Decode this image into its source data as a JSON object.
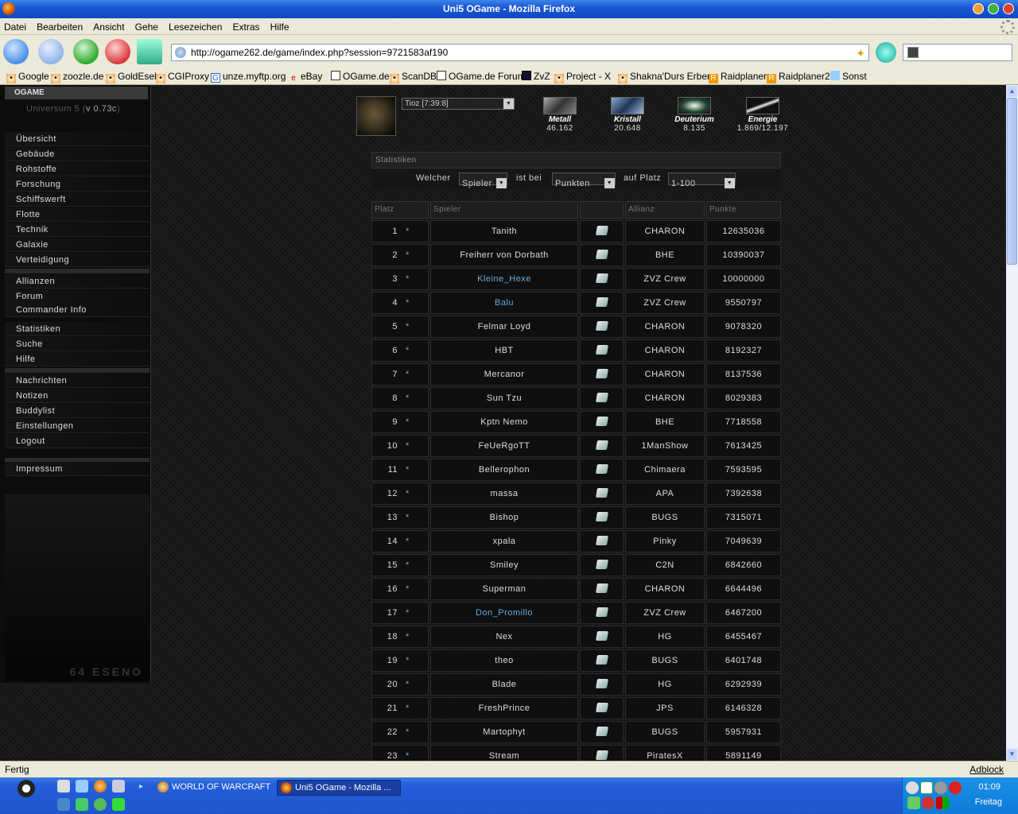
{
  "window": {
    "title": "Uni5 OGame - Mozilla Firefox"
  },
  "menubar": [
    "Datei",
    "Bearbeiten",
    "Ansicht",
    "Gehe",
    "Lesezeichen",
    "Extras",
    "Hilfe"
  ],
  "toolbar": {
    "url": "http://ogame262.de/game/index.php?session=9721583af190",
    "search_value": ""
  },
  "bookmarks": [
    "Google",
    "zoozle.de",
    "GoldEsel",
    "CGIProxy",
    "unze.myftp.org",
    "eBay",
    "OGame.de",
    "ScanDB",
    "OGame.de Forum",
    "ZvZ",
    "Project - X",
    "Shakna'Durs Erben",
    "Raidplaner",
    "Raidplaner2",
    "Sonst"
  ],
  "sidebar": {
    "logo": "OGAME",
    "universe": "Universum 5 (",
    "version": "v 0.73c",
    "universe_close": ")",
    "group1": [
      "Übersicht",
      "Gebäude",
      "Rohstoffe",
      "Forschung",
      "Schiffswerft",
      "Flotte",
      "Technik",
      "Galaxie",
      "Verteidigung"
    ],
    "group2": [
      "Allianzen",
      "Forum",
      "Commander Info",
      "Statistiken",
      "Suche",
      "Hilfe"
    ],
    "group3": [
      "Nachrichten",
      "Notizen",
      "Buddylist",
      "Einstellungen",
      "Logout"
    ],
    "group4": [
      "Impressum"
    ],
    "footer": "64 ESENO"
  },
  "header": {
    "planet": "Tioz [7:39:8]",
    "resources": [
      {
        "name": "Metall",
        "value": "46.162"
      },
      {
        "name": "Kristall",
        "value": "20.648"
      },
      {
        "name": "Deuterium",
        "value": "8.135"
      },
      {
        "name": "Energie",
        "value": "1.869/12.197"
      }
    ]
  },
  "stats": {
    "title": "Statistiken",
    "filter": {
      "who_label": "Welcher",
      "who_value": "Spieler",
      "by_label": "ist bei",
      "by_value": "Punkten",
      "place_label": "auf Platz",
      "place_value": "1-100"
    },
    "columns": {
      "rank": "Platz",
      "player": "Spieler",
      "alliance": "Allianz",
      "points": "Punkte"
    },
    "rows": [
      {
        "rank": "1",
        "mark": "*",
        "player": "Tanith",
        "ally": "CHARON",
        "points": "12635036",
        "own": false
      },
      {
        "rank": "2",
        "mark": "*",
        "player": "Freiherr von Dorbath",
        "ally": "BHE",
        "points": "10390037",
        "own": false
      },
      {
        "rank": "3",
        "mark": "*",
        "player": "Kleine_Hexe",
        "ally": "ZVZ Crew",
        "points": "10000000",
        "own": true
      },
      {
        "rank": "4",
        "mark": "*",
        "player": "Balu",
        "ally": "ZVZ Crew",
        "points": "9550797",
        "own": true
      },
      {
        "rank": "5",
        "mark": "*",
        "player": "Felmar Loyd",
        "ally": "CHARON",
        "points": "9078320",
        "own": false
      },
      {
        "rank": "6",
        "mark": "*",
        "player": "HBT",
        "ally": "CHARON",
        "points": "8192327",
        "own": false
      },
      {
        "rank": "7",
        "mark": "*",
        "player": "Mercanor",
        "ally": "CHARON",
        "points": "8137536",
        "own": false
      },
      {
        "rank": "8",
        "mark": "*",
        "player": "Sun Tzu",
        "ally": "CHARON",
        "points": "8029383",
        "own": false
      },
      {
        "rank": "9",
        "mark": "*",
        "player": "Kptn Nemo",
        "ally": "BHE",
        "points": "7718558",
        "own": false
      },
      {
        "rank": "10",
        "mark": "*",
        "player": "FeUeRgoTT",
        "ally": "1ManShow",
        "points": "7613425",
        "own": false
      },
      {
        "rank": "11",
        "mark": "*",
        "player": "Bellerophon",
        "ally": "Chimaera",
        "points": "7593595",
        "own": false
      },
      {
        "rank": "12",
        "mark": "*",
        "player": "massa",
        "ally": "APA",
        "points": "7392638",
        "own": false
      },
      {
        "rank": "13",
        "mark": "*",
        "player": "Bishop",
        "ally": "BUGS",
        "points": "7315071",
        "own": false
      },
      {
        "rank": "14",
        "mark": "*",
        "player": "xpala",
        "ally": "Pinky",
        "points": "7049639",
        "own": false
      },
      {
        "rank": "15",
        "mark": "*",
        "player": "Smiley",
        "ally": "C2N",
        "points": "6842660",
        "own": false
      },
      {
        "rank": "16",
        "mark": "*",
        "player": "Superman",
        "ally": "CHARON",
        "points": "6644496",
        "own": false
      },
      {
        "rank": "17",
        "mark": "*",
        "player": "Don_Promillo",
        "ally": "ZVZ Crew",
        "points": "6467200",
        "own": true
      },
      {
        "rank": "18",
        "mark": "*",
        "player": "Nex",
        "ally": "HG",
        "points": "6455467",
        "own": false
      },
      {
        "rank": "19",
        "mark": "*",
        "player": "theo",
        "ally": "BUGS",
        "points": "6401748",
        "own": false
      },
      {
        "rank": "20",
        "mark": "*",
        "player": "Blade",
        "ally": "HG",
        "points": "6292939",
        "own": false
      },
      {
        "rank": "21",
        "mark": "*",
        "player": "FreshPrince",
        "ally": "JPS",
        "points": "6146328",
        "own": false
      },
      {
        "rank": "22",
        "mark": "*",
        "player": "Martophyt",
        "ally": "BUGS",
        "points": "5957931",
        "own": false
      },
      {
        "rank": "23",
        "mark": "*",
        "player": "Stream",
        "ally": "PiratesX",
        "points": "5891149",
        "own": false
      }
    ]
  },
  "statusbar": {
    "text": "Fertig",
    "adblock": "Adblock"
  },
  "taskbar": {
    "tasks": [
      "WORLD OF WARCRAFT",
      "Uni5 OGame - Mozilla ..."
    ],
    "clock": "01:09",
    "day": "Freitag"
  },
  "colors": {
    "ally_highlight": "#66aadd",
    "star": "#6fa8dc",
    "title_bar": "#1a57d6"
  }
}
